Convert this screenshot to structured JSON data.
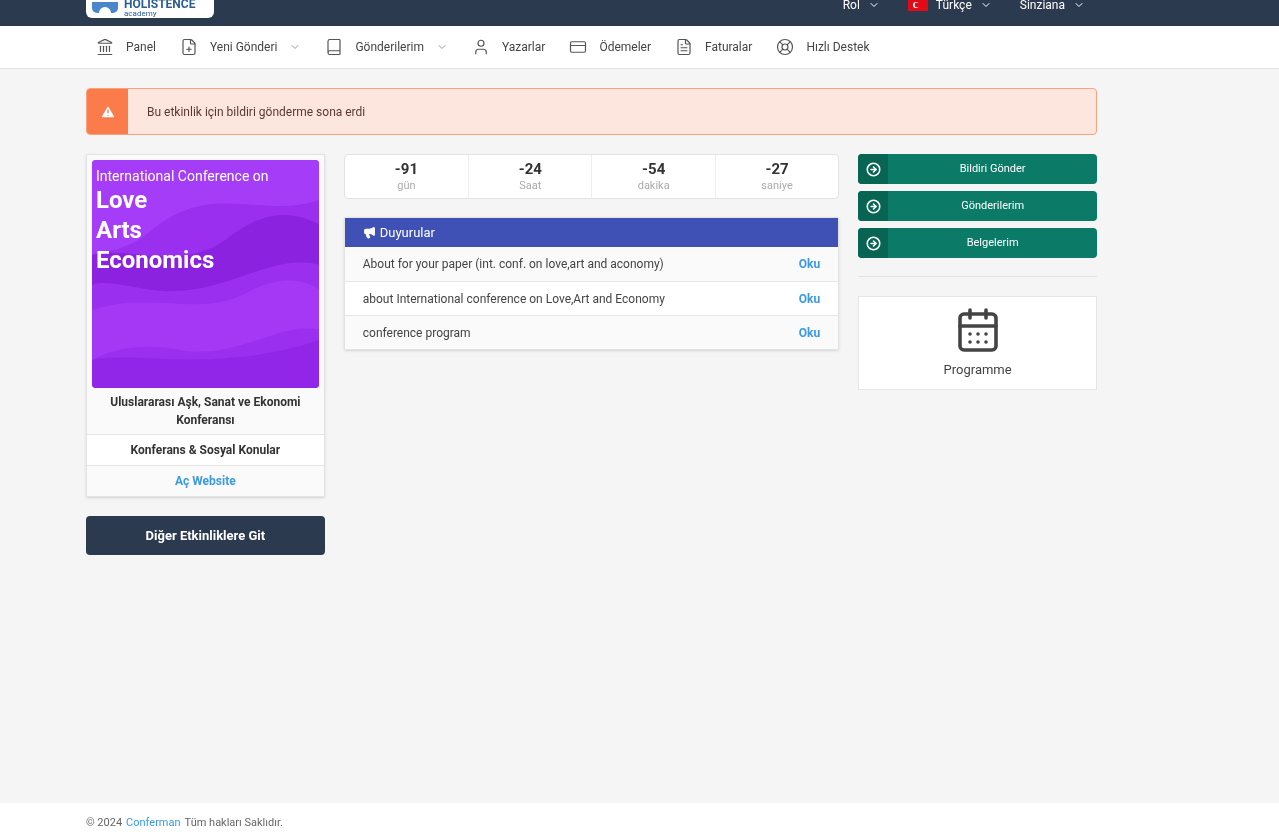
{
  "header": {
    "logo": {
      "name": "HOLISTENCE",
      "tagline": "academy"
    },
    "menus": [
      {
        "label": "Rol",
        "kind": "plain"
      },
      {
        "label": "Türkçe",
        "kind": "flag"
      },
      {
        "label": "Sinziana",
        "kind": "plain"
      }
    ]
  },
  "nav": [
    {
      "label": "Panel",
      "dropdown": false
    },
    {
      "label": "Yeni Gönderi",
      "dropdown": true
    },
    {
      "label": "Gönderilerim",
      "dropdown": true
    },
    {
      "label": "Yazarlar",
      "dropdown": false
    },
    {
      "label": "Ödemeler",
      "dropdown": false
    },
    {
      "label": "Faturalar",
      "dropdown": false
    },
    {
      "label": "Hızlı Destek",
      "dropdown": false
    }
  ],
  "alert": {
    "text": "Bu etkinlik için bildiri gönderme sona erdi"
  },
  "event": {
    "poster": {
      "kicker": "International Conference on",
      "lines": [
        "Love",
        "Arts",
        "Economics"
      ]
    },
    "title": "Uluslararası Aşk, Sanat ve Ekonomi Konferansı",
    "category": "Konferans & Sosyal Konular",
    "link": "Aç Website"
  },
  "other_events_button": "Diğer Etkinliklere Git",
  "countdown": [
    {
      "value": "-91",
      "unit": "gün"
    },
    {
      "value": "-24",
      "unit": "Saat"
    },
    {
      "value": "-54",
      "unit": "dakika"
    },
    {
      "value": "-27",
      "unit": "saniye"
    }
  ],
  "announcements": {
    "title": "Duyurular",
    "items": [
      {
        "text": "About for your paper (int. conf. on love,art and aconomy)",
        "action": "Oku"
      },
      {
        "text": "about International conference on Love,Art and Economy",
        "action": "Oku"
      },
      {
        "text": "conference program",
        "action": "Oku"
      }
    ]
  },
  "actions": [
    "Bildiri Gönder",
    "Gönderilerim",
    "Belgelerim"
  ],
  "programme": {
    "label": "Programme"
  },
  "footer": {
    "year": "© 2024",
    "link": "Conferman",
    "rest": "Tüm hakları Saklıdır."
  }
}
